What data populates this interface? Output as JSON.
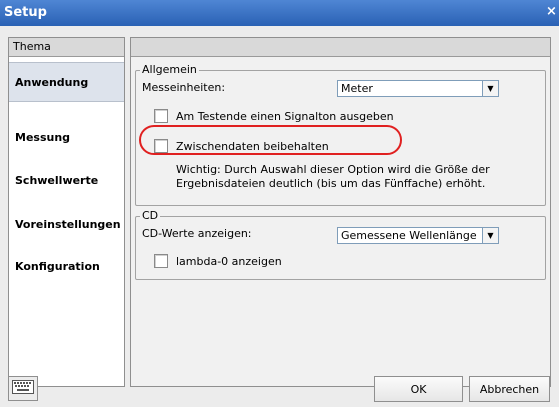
{
  "window": {
    "title": "Setup",
    "close_glyph": "×"
  },
  "sidebar": {
    "header": "Thema",
    "items": [
      {
        "label": "Anwendung",
        "active": true
      },
      {
        "label": "Messung"
      },
      {
        "label": "Schwellwerte"
      },
      {
        "label": "Voreinstellungen"
      },
      {
        "label": "Konfiguration"
      }
    ]
  },
  "general": {
    "legend": "Allgemein",
    "units_label": "Messeinheiten:",
    "units_value": "Meter",
    "beep_label": "Am Testende einen Signalton ausgeben",
    "beep_checked": false,
    "keep_temp_label": "Zwischendaten beibehalten",
    "keep_temp_checked": false,
    "note_line1": "Wichtig: Durch Auswahl dieser Option wird die Größe der",
    "note_line2": "Ergebnisdateien deutlich (bis um das Fünffache) erhöht."
  },
  "cd": {
    "legend": "CD",
    "values_label": "CD-Werte anzeigen:",
    "values_value": "Gemessene Wellenlänge",
    "lambda_label": "lambda-0 anzeigen",
    "lambda_checked": false
  },
  "footer": {
    "keyboard_icon": "keyboard-icon",
    "ok_label": "OK",
    "cancel_label": "Abbrechen"
  },
  "colors": {
    "titlebar": "#2a61b4",
    "highlight": "#e02020",
    "active_item": "#dde3ec"
  }
}
